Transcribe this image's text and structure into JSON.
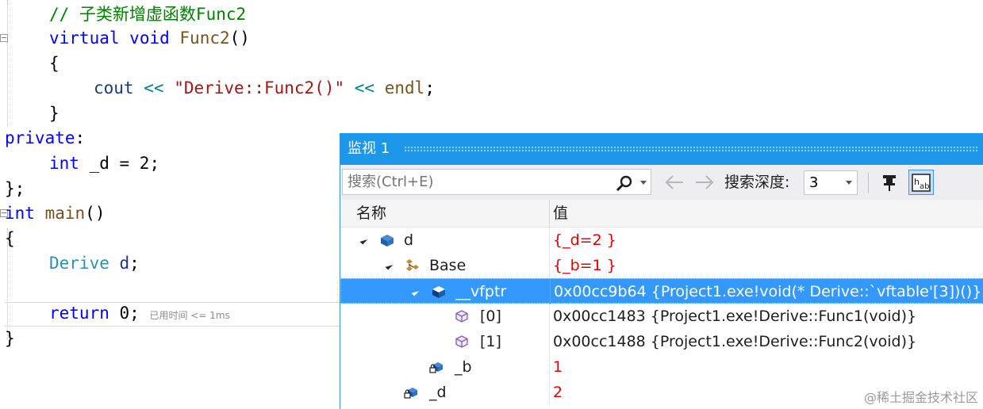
{
  "editor": {
    "line1_comment": "// 子类新增虚函数Func2",
    "line2_kw": "virtual",
    "line2_type": "void",
    "line2_fn": "Func2",
    "line2_rest": "()",
    "line3": "{",
    "line4_cout": "cout",
    "line4_op1": "<<",
    "line4_str": "\"Derive::Func2()\"",
    "line4_op2": "<<",
    "line4_endl": "endl",
    "line4_semi": ";",
    "line5": "}",
    "line6_kw": "private",
    "line6_colon": ":",
    "line7_type": "int",
    "line7_rest": "_d = 2;",
    "line8": "};",
    "line9_type": "int",
    "line9_fn": "main",
    "line9_rest": "()",
    "line10": "{",
    "line11_type": "Derive",
    "line11_var": "d",
    "line11_semi": ";",
    "line13_kw": "return",
    "line13_rest": "0;",
    "line13_elapsed": "已用时间 <= 1ms",
    "line14": "}"
  },
  "watch": {
    "title": "监视 1",
    "search_placeholder": "搜索(Ctrl+E)",
    "depth_label": "搜索深度:",
    "depth_value": "3",
    "col_name": "名称",
    "col_value": "值",
    "rows": [
      {
        "name": "d",
        "value": "{_d=2 }",
        "icon": "object-icon"
      },
      {
        "name": "Base",
        "value": "{_b=1 }",
        "icon": "base-class-icon"
      },
      {
        "name": "__vfptr",
        "value": "0x00cc9b64 {Project1.exe!void(* Derive::`vftable'[3])()}",
        "icon": "object-icon"
      },
      {
        "name": "[0]",
        "value": "0x00cc1483 {Project1.exe!Derive::Func1(void)}",
        "icon": "method-icon"
      },
      {
        "name": "[1]",
        "value": "0x00cc1488 {Project1.exe!Derive::Func2(void)}",
        "icon": "method-icon"
      },
      {
        "name": "_b",
        "value": "1",
        "icon": "private-field-icon"
      },
      {
        "name": "_d",
        "value": "2",
        "icon": "private-field-icon"
      }
    ]
  },
  "watermark": "@稀土掘金技术社区",
  "colors": {
    "title_bar": "#1c97ea",
    "selection": "#3399ff",
    "value_changed": "#e00000"
  }
}
